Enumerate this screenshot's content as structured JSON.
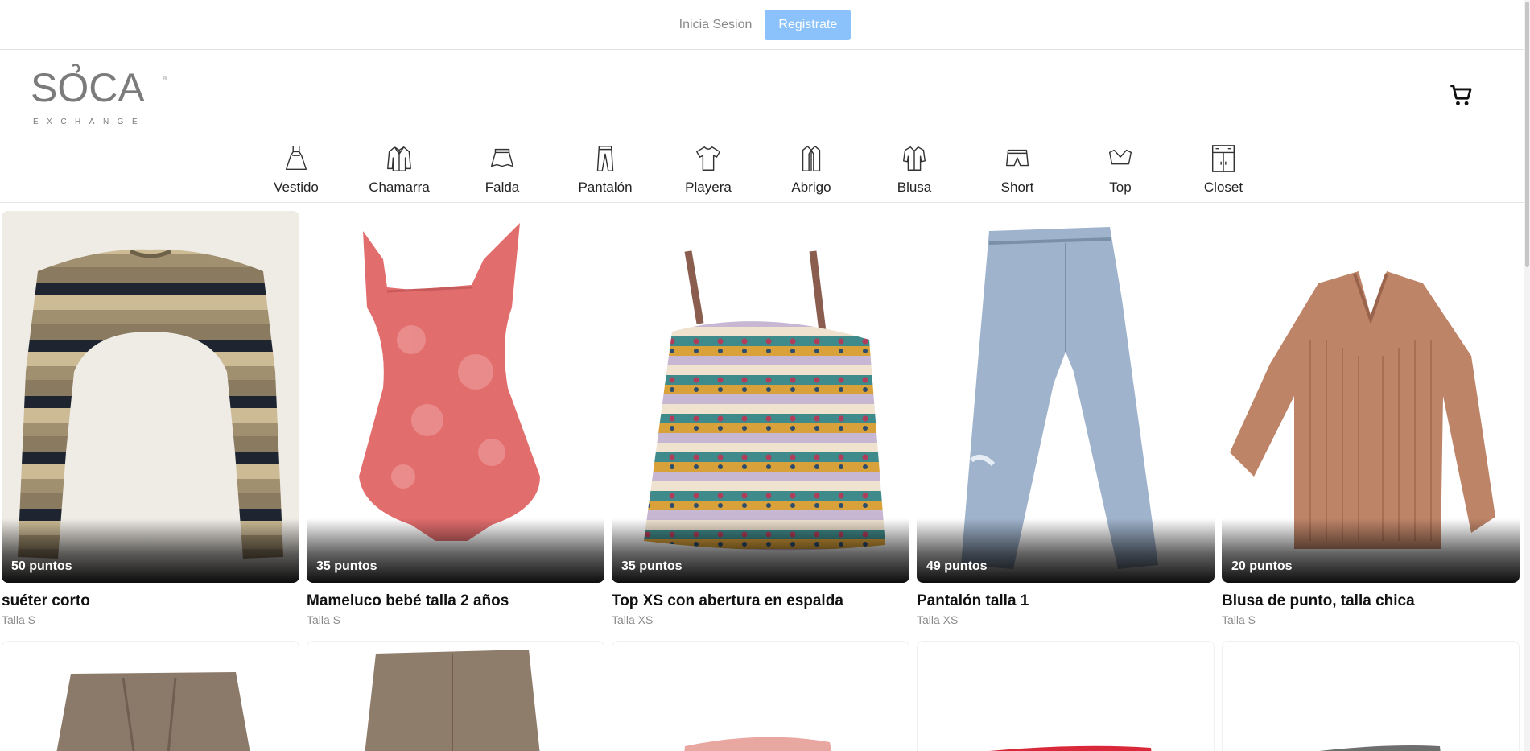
{
  "top_bar": {
    "login_label": "Inicia Sesion",
    "register_label": "Registrate"
  },
  "logo": {
    "brand": "SOCA",
    "tagline": "EXCHANGE"
  },
  "categories": [
    {
      "label": "Vestido",
      "icon": "dress-icon"
    },
    {
      "label": "Chamarra",
      "icon": "jacket-icon"
    },
    {
      "label": "Falda",
      "icon": "skirt-icon"
    },
    {
      "label": "Pantalón",
      "icon": "pants-icon"
    },
    {
      "label": "Playera",
      "icon": "tshirt-icon"
    },
    {
      "label": "Abrigo",
      "icon": "coat-icon"
    },
    {
      "label": "Blusa",
      "icon": "blouse-icon"
    },
    {
      "label": "Short",
      "icon": "shorts-icon"
    },
    {
      "label": "Top",
      "icon": "top-icon"
    },
    {
      "label": "Closet",
      "icon": "closet-icon"
    }
  ],
  "products": [
    {
      "points": "50 puntos",
      "title": "suéter corto",
      "size": "Talla S",
      "image": "striped-cropped-sweater"
    },
    {
      "points": "35 puntos",
      "title": "Mameluco bebé talla 2 años",
      "size": "Talla S",
      "image": "pink-baby-romper"
    },
    {
      "points": "35 puntos",
      "title": "Top XS con abertura en espalda",
      "size": "Talla XS",
      "image": "patterned-strap-top"
    },
    {
      "points": "49 puntos",
      "title": "Pantalón talla 1",
      "size": "Talla XS",
      "image": "light-blue-jeans"
    },
    {
      "points": "20 puntos",
      "title": "Blusa de punto, talla chica",
      "size": "Talla S",
      "image": "tan-knit-blouse"
    }
  ],
  "colors": {
    "register_button": "#8cc2fb",
    "text": "#111111",
    "muted": "#8a8a8a"
  }
}
